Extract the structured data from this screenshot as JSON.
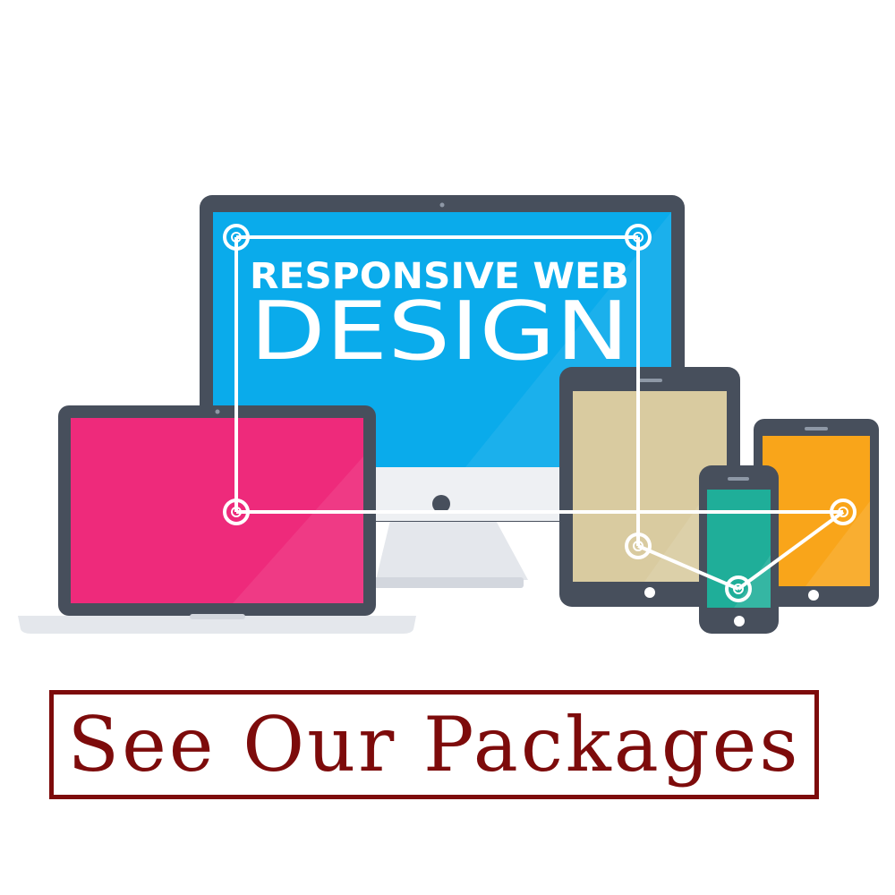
{
  "hero": {
    "headline_line1": "RESPONSIVE WEB",
    "headline_line2": "DESIGN"
  },
  "cta": {
    "label": "See Our Packages"
  },
  "colors": {
    "device_frame": "#474f5c",
    "monitor_screen": "#0aabeb",
    "laptop_screen": "#ee2a7b",
    "tablet_screen": "#d9cba0",
    "phone_screen": "#1fae99",
    "small_tablet_screen": "#f9a51a",
    "stand": "#e4e7ec",
    "cta_border": "#7d0b0b",
    "cta_text": "#7d0b0b"
  },
  "icons": [
    "monitor-icon",
    "laptop-icon",
    "tablet-icon",
    "phone-icon",
    "small-tablet-icon",
    "connector-node-icon"
  ]
}
